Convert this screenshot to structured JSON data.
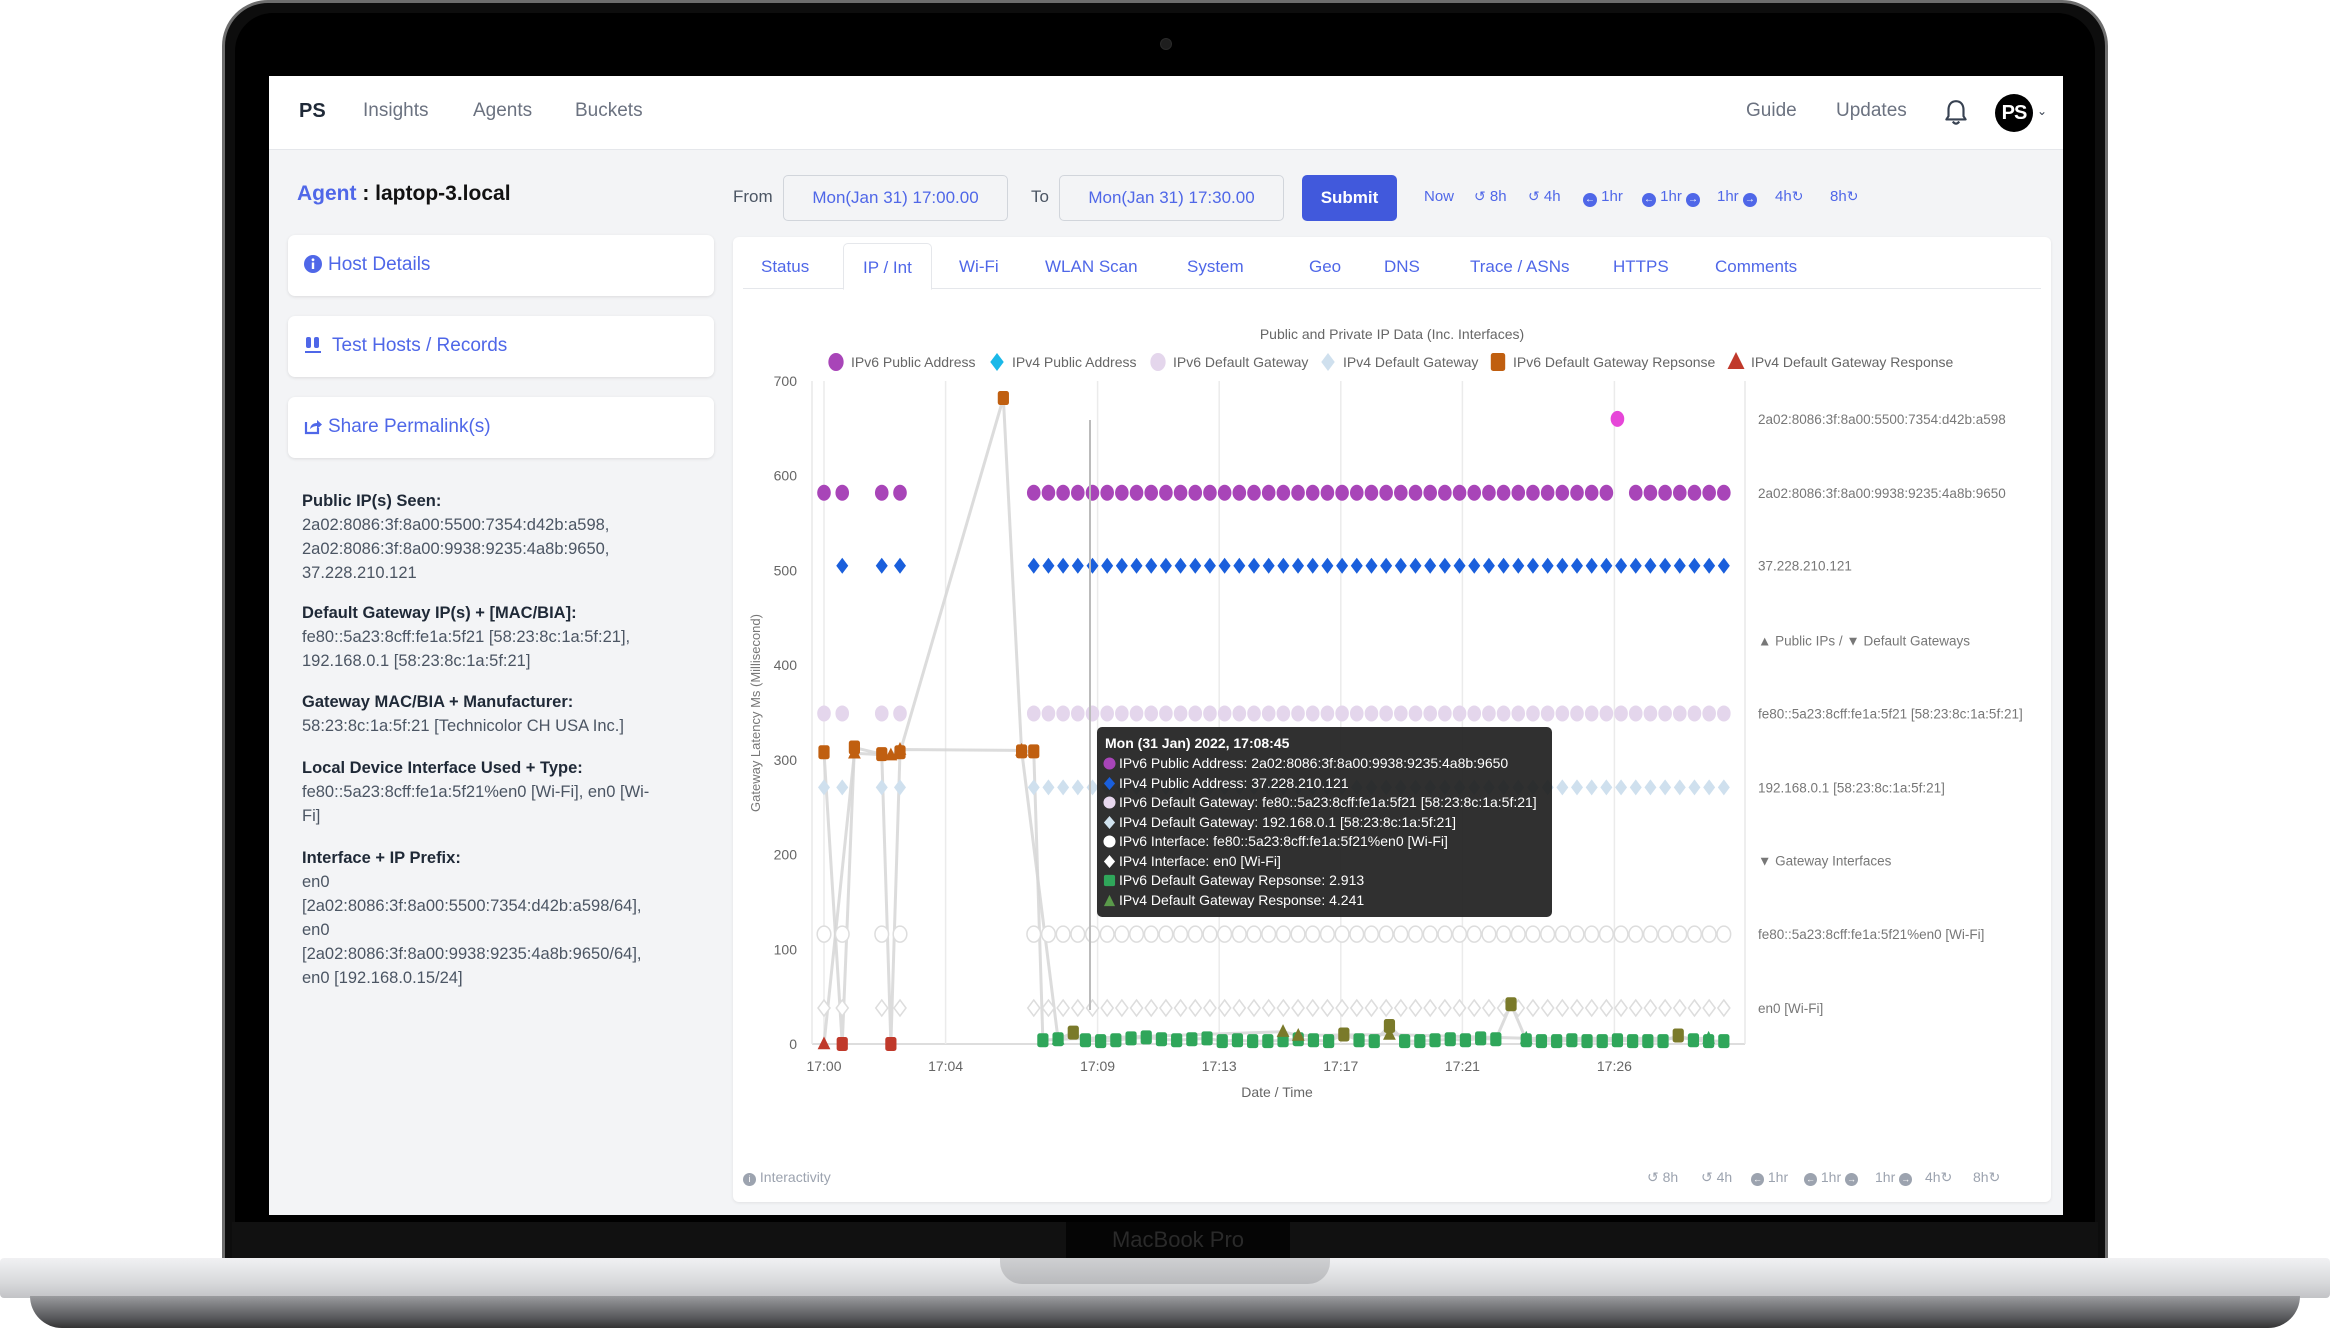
{
  "device": {
    "label": "MacBook Pro"
  },
  "navbar": {
    "brand": "PS",
    "links": [
      "Insights",
      "Agents",
      "Buckets"
    ],
    "right_links": [
      "Guide",
      "Updates"
    ],
    "avatar_initials": "PS"
  },
  "agent": {
    "label": "Agent",
    "separator": " : ",
    "name": "laptop-3.local"
  },
  "sidebar": {
    "cards": [
      {
        "icon": "info-circle-icon",
        "label": "Host Details"
      },
      {
        "icon": "test-tubes-icon",
        "label": "Test Hosts / Records"
      },
      {
        "icon": "share-icon",
        "label": "Share Permalink(s)"
      }
    ],
    "info": [
      {
        "heading": "Public IP(s) Seen:",
        "lines": [
          "2a02:8086:3f:8a00:5500:7354:d42b:a598,",
          "2a02:8086:3f:8a00:9938:9235:4a8b:9650,",
          "37.228.210.121"
        ]
      },
      {
        "heading": "Default Gateway IP(s) + [MAC/BIA]:",
        "lines": [
          "fe80::5a23:8cff:fe1a:5f21 [58:23:8c:1a:5f:21],",
          "192.168.0.1 [58:23:8c:1a:5f:21]"
        ]
      },
      {
        "heading": "Gateway MAC/BIA + Manufacturer:",
        "lines": [
          "58:23:8c:1a:5f:21 [Technicolor CH USA Inc.]"
        ]
      },
      {
        "heading": "Local Device Interface Used + Type:",
        "lines": [
          "fe80::5a23:8cff:fe1a:5f21%en0 [Wi-Fi], en0 [Wi-",
          "Fi]"
        ]
      },
      {
        "heading": "Interface + IP Prefix:",
        "lines": [
          "en0",
          "[2a02:8086:3f:8a00:5500:7354:d42b:a598/64],",
          "en0",
          "[2a02:8086:3f:8a00:9938:9235:4a8b:9650/64],",
          "en0 [192.168.0.15/24]"
        ]
      }
    ]
  },
  "range": {
    "from_label": "From",
    "from_value": "Mon(Jan 31) 17:00.00",
    "to_label": "To",
    "to_value": "Mon(Jan 31) 17:30.00",
    "submit_label": "Submit",
    "quick": [
      {
        "label": "Now"
      },
      {
        "label": "8h",
        "icon": "history-icon"
      },
      {
        "label": "4h",
        "icon": "history-icon"
      },
      {
        "label": "1hr",
        "icon": "arrow-left-circle-icon"
      },
      {
        "label": "1hr",
        "icon": "arrow-left-right-circle-icon"
      },
      {
        "label": "1hr",
        "icon": "arrow-right-circle-icon"
      },
      {
        "label": "4h",
        "icon": "redo-icon"
      },
      {
        "label": "8h",
        "icon": "redo-icon"
      }
    ]
  },
  "tabs": [
    "Status",
    "IP / Int",
    "Wi-Fi",
    "WLAN Scan",
    "System",
    "Geo",
    "DNS",
    "Trace / ASNs",
    "HTTPS",
    "Comments"
  ],
  "active_tab": "IP / Int",
  "footer": {
    "interactivity_label": "Interactivity",
    "quick": [
      "8h",
      "4h",
      "1hr",
      "1hr",
      "1hr",
      "4h",
      "8h"
    ]
  },
  "colors": {
    "accent": "#4f67e8",
    "submit": "#4159dc",
    "ipv6_public": "#a845b8",
    "ipv6_public_alt": "#e646d8",
    "ipv4_public": "#1a5fdc",
    "ipv6_gateway": "#e4d6ec",
    "ipv4_gateway": "#cfe0ee",
    "interface": "#e0e0e0",
    "ipv6_gw_resp": "#c05f10",
    "ipv4_gw_resp": "#c0392b",
    "resp_ok": "#2fa65a",
    "resp_mid": "#7a7a2a"
  },
  "chart_data": {
    "type": "scatter",
    "title": "Public and Private IP Data (Inc. Interfaces)",
    "xlabel": "Date / Time",
    "ylabel": "Gateway Latency Ms (Millisecond)",
    "ylim": [
      0,
      700
    ],
    "yticks": [
      0,
      100,
      200,
      300,
      400,
      500,
      600,
      700
    ],
    "xlim_minutes": [
      -0.2,
      29.8
    ],
    "xtick_minutes": [
      0,
      4,
      9,
      13,
      17,
      21,
      26
    ],
    "xtick_labels": [
      "17:00",
      "17:04",
      "17:09",
      "17:13",
      "17:17",
      "17:21",
      "17:26"
    ],
    "grid": true,
    "legend_position": "top",
    "legend": [
      {
        "name": "IPv6 Public Address",
        "symbol": "circle",
        "color": "#a845b8"
      },
      {
        "name": "IPv4 Public Address",
        "symbol": "diamond",
        "color": "#1ab8e8"
      },
      {
        "name": "IPv6 Default Gateway",
        "symbol": "circle",
        "color": "#e4d6ec"
      },
      {
        "name": "IPv4 Default Gateway",
        "symbol": "diamond",
        "color": "#cfe0ee"
      },
      {
        "name": "IPv6 Default Gateway Repsonse",
        "symbol": "square",
        "color": "#c05f10"
      },
      {
        "name": "IPv4 Default Gateway Response",
        "symbol": "triangle",
        "color": "#c0392b"
      }
    ],
    "right_annotations": [
      {
        "y": 660,
        "text": "2a02:8086:3f:8a00:5500:7354:d42b:a598"
      },
      {
        "y": 582,
        "text": "2a02:8086:3f:8a00:9938:9235:4a8b:9650"
      },
      {
        "y": 505,
        "text": "37.228.210.121"
      },
      {
        "y": 426,
        "text": "▲ Public IPs / ▼ Default Gateways"
      },
      {
        "y": 349,
        "text": "fe80::5a23:8cff:fe1a:5f21 [58:23:8c:1a:5f:21]"
      },
      {
        "y": 271,
        "text": "192.168.0.1 [58:23:8c:1a:5f:21]"
      },
      {
        "y": 194,
        "text": "▼ Gateway Interfaces"
      },
      {
        "y": 116,
        "text": "fe80::5a23:8cff:fe1a:5f21%en0 [Wi-Fi]"
      },
      {
        "y": 38,
        "text": "en0 [Wi-Fi]"
      }
    ],
    "sample_minutes_early": [
      0,
      0.6,
      1.9,
      2.5
    ],
    "sample_minutes_main_start": 6.9,
    "sample_minutes_main_end": 29.6,
    "sample_count_main": 48,
    "lanes": [
      {
        "series": "IPv6 Public Address (a598)",
        "y": 660,
        "minutes": [
          26.1
        ],
        "symbol": "circle",
        "color": "#e646d8"
      },
      {
        "series": "IPv6 Public Address (9650)",
        "y": 582,
        "gap_minutes": [
          26.1
        ],
        "symbol": "circle",
        "color": "#a845b8",
        "early_minutes": [
          0,
          0.6,
          1.9,
          2.5
        ]
      },
      {
        "series": "IPv4 Public Address",
        "y": 505,
        "symbol": "diamond",
        "color": "#1a5fdc",
        "early_minutes": [
          0.6,
          1.9,
          2.5
        ]
      },
      {
        "series": "IPv6 Default Gateway",
        "y": 349,
        "symbol": "circle",
        "color": "#e4d6ec",
        "early_minutes": [
          0,
          0.6,
          1.9,
          2.5
        ]
      },
      {
        "series": "IPv4 Default Gateway",
        "y": 271,
        "symbol": "diamond",
        "color": "#cfe0ee",
        "early_minutes": [
          0,
          0.6,
          1.9,
          2.5
        ]
      },
      {
        "series": "IPv6 Interface",
        "y": 116,
        "symbol": "circle-outline",
        "color": "#dddddd",
        "early_minutes": [
          0,
          0.6,
          1.9,
          2.5
        ]
      },
      {
        "series": "IPv4 Interface",
        "y": 38,
        "symbol": "diamond-outline",
        "color": "#dddddd",
        "early_minutes": [
          0,
          0.6,
          1.9,
          2.5
        ]
      }
    ],
    "latency_series": [
      {
        "name": "IPv6 Default Gateway Repsonse",
        "points": [
          {
            "t": 0,
            "v": 308
          },
          {
            "t": 0.6,
            "v": 0
          },
          {
            "t": 1.0,
            "v": 313
          },
          {
            "t": 1.9,
            "v": 306
          },
          {
            "t": 2.2,
            "v": 0
          },
          {
            "t": 2.5,
            "v": 308
          },
          {
            "t": 5.9,
            "v": 682
          },
          {
            "t": 6.5,
            "v": 309
          },
          {
            "t": 6.9,
            "v": 309
          },
          {
            "t": 7.2,
            "v": 4
          },
          {
            "t": 7.7,
            "v": 5
          },
          {
            "t": 8.2,
            "v": 12
          },
          {
            "t": 8.6,
            "v": 4
          },
          {
            "t": 9.1,
            "v": 3
          },
          {
            "t": 9.6,
            "v": 4
          },
          {
            "t": 10.1,
            "v": 6
          },
          {
            "t": 10.6,
            "v": 7
          },
          {
            "t": 11.1,
            "v": 5
          },
          {
            "t": 11.6,
            "v": 4
          },
          {
            "t": 12.1,
            "v": 5
          },
          {
            "t": 12.6,
            "v": 6
          },
          {
            "t": 13.1,
            "v": 3
          },
          {
            "t": 13.6,
            "v": 4
          },
          {
            "t": 14.1,
            "v": 3
          },
          {
            "t": 14.6,
            "v": 3
          },
          {
            "t": 15.1,
            "v": 4
          },
          {
            "t": 15.6,
            "v": 5
          },
          {
            "t": 16.1,
            "v": 4
          },
          {
            "t": 16.6,
            "v": 3
          },
          {
            "t": 17.1,
            "v": 10
          },
          {
            "t": 17.6,
            "v": 4
          },
          {
            "t": 18.1,
            "v": 3
          },
          {
            "t": 18.6,
            "v": 19
          },
          {
            "t": 19.1,
            "v": 3
          },
          {
            "t": 19.6,
            "v": 3
          },
          {
            "t": 20.1,
            "v": 4
          },
          {
            "t": 20.6,
            "v": 5
          },
          {
            "t": 21.1,
            "v": 4
          },
          {
            "t": 21.6,
            "v": 6
          },
          {
            "t": 22.1,
            "v": 5
          },
          {
            "t": 22.6,
            "v": 42
          },
          {
            "t": 23.1,
            "v": 4
          },
          {
            "t": 23.6,
            "v": 3
          },
          {
            "t": 24.1,
            "v": 3
          },
          {
            "t": 24.6,
            "v": 4
          },
          {
            "t": 25.1,
            "v": 3
          },
          {
            "t": 25.6,
            "v": 3
          },
          {
            "t": 26.1,
            "v": 4
          },
          {
            "t": 26.6,
            "v": 3
          },
          {
            "t": 27.1,
            "v": 3
          },
          {
            "t": 27.6,
            "v": 3
          },
          {
            "t": 28.1,
            "v": 9
          },
          {
            "t": 28.6,
            "v": 4
          },
          {
            "t": 29.1,
            "v": 3
          },
          {
            "t": 29.6,
            "v": 3
          }
        ]
      },
      {
        "name": "IPv4 Default Gateway Response",
        "points": [
          {
            "t": 0,
            "v": 0
          },
          {
            "t": 1.0,
            "v": 307
          },
          {
            "t": 2.2,
            "v": 305
          },
          {
            "t": 2.5,
            "v": 311
          },
          {
            "t": 6.5,
            "v": 310
          },
          {
            "t": 7.7,
            "v": 5
          },
          {
            "t": 15.1,
            "v": 13
          },
          {
            "t": 15.6,
            "v": 9
          },
          {
            "t": 18.6,
            "v": 10
          },
          {
            "t": 23.1,
            "v": 6
          },
          {
            "t": 29.1,
            "v": 6
          }
        ]
      }
    ],
    "hover_line_minute": 8.75,
    "tooltip": {
      "title": "Mon (31 Jan) 2022, 17:08:45",
      "rows": [
        {
          "symbol": "circle",
          "color": "#a845b8",
          "text": "IPv6 Public Address: 2a02:8086:3f:8a00:9938:9235:4a8b:9650"
        },
        {
          "symbol": "diamond",
          "color": "#1a5fdc",
          "text": "IPv4 Public Address: 37.228.210.121"
        },
        {
          "symbol": "circle",
          "color": "#e8d8ee",
          "text": "IPv6 Default Gateway: fe80::5a23:8cff:fe1a:5f21 [58:23:8c:1a:5f:21]"
        },
        {
          "symbol": "diamond",
          "color": "#d2e4f0",
          "text": "IPv4 Default Gateway: 192.168.0.1 [58:23:8c:1a:5f:21]"
        },
        {
          "symbol": "circle",
          "color": "#ffffff",
          "text": "IPv6 Interface: fe80::5a23:8cff:fe1a:5f21%en0 [Wi-Fi]"
        },
        {
          "symbol": "diamond",
          "color": "#ffffff",
          "text": "IPv4 Interface: en0 [Wi-Fi]"
        },
        {
          "symbol": "square",
          "color": "#2fa65a",
          "text": "IPv6 Default Gateway Repsonse: 2.913"
        },
        {
          "symbol": "triangle",
          "color": "#5a9a4a",
          "text": "IPv4 Default Gateway Response: 4.241"
        }
      ]
    }
  }
}
